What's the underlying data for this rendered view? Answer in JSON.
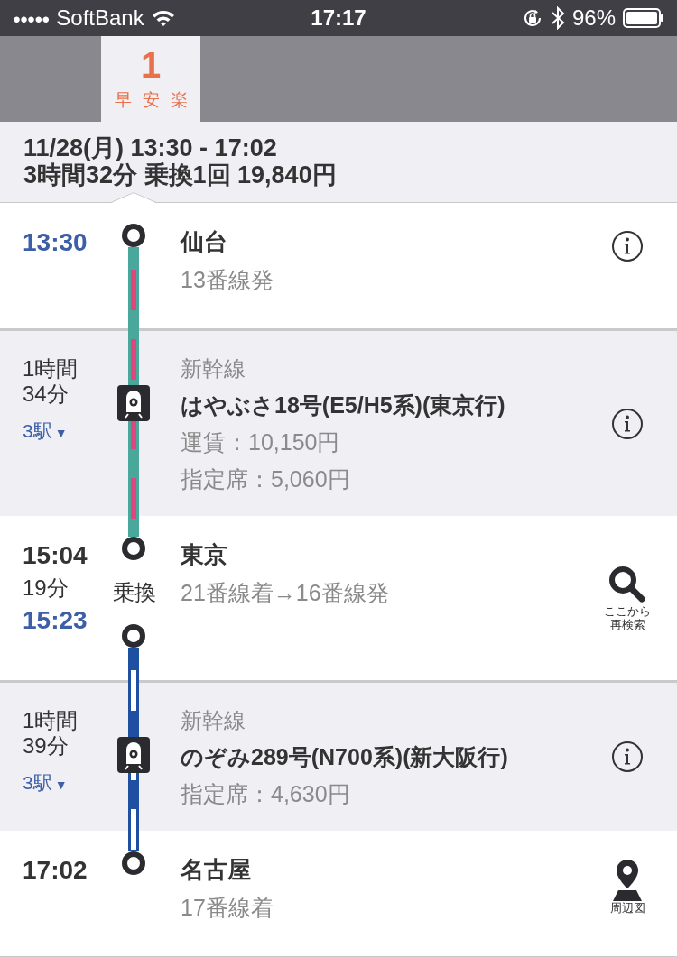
{
  "status_bar": {
    "signal": "●●●●●",
    "carrier": "SoftBank",
    "time": "17:17",
    "battery": "96%"
  },
  "tabs": [
    {
      "number": "1",
      "labels": [
        "早",
        "安",
        "楽"
      ],
      "selected": true
    }
  ],
  "summary": {
    "line1": "11/28(月) 13:30 - 17:02",
    "line2": "3時間32分 乗換1回 19,840円"
  },
  "legs": [
    {
      "kind": "station",
      "time": "13:30",
      "departure": true,
      "name": "仙台",
      "detail": "13番線発",
      "action": {
        "kind": "info"
      }
    },
    {
      "kind": "train",
      "duration": [
        "1時間",
        "34分"
      ],
      "stops": "3駅",
      "stops_caret": "▼",
      "category": "新幹線",
      "name": "はやぶさ18号(E5/H5系)(東京行)",
      "fares": [
        "運賃：10,150円",
        "指定席：5,060円"
      ],
      "color": "#4aa79b",
      "stripe": {
        "color": "#e0457b"
      },
      "action": {
        "kind": "info"
      }
    },
    {
      "kind": "transfer",
      "times": [
        {
          "time": "15:04",
          "departure": false
        },
        {
          "time": "15:23",
          "departure": true
        }
      ],
      "wait": "19分",
      "transfer_label": "乗換",
      "name": "東京",
      "detail": "21番線着→16番線発",
      "action": {
        "kind": "search",
        "label": [
          "ここから",
          "再検索"
        ]
      }
    },
    {
      "kind": "train",
      "duration": [
        "1時間",
        "39分"
      ],
      "stops": "3駅",
      "stops_caret": "▼",
      "category": "新幹線",
      "name": "のぞみ289号(N700系)(新大阪行)",
      "fares": [
        "指定席：4,630円"
      ],
      "color": "#1f4fa0",
      "stripe": {
        "color": "#ffffff"
      },
      "action": {
        "kind": "info"
      }
    },
    {
      "kind": "station",
      "time": "17:02",
      "departure": false,
      "name": "名古屋",
      "detail": "17番線着",
      "action": {
        "kind": "map",
        "label": [
          "周辺図"
        ]
      }
    }
  ]
}
